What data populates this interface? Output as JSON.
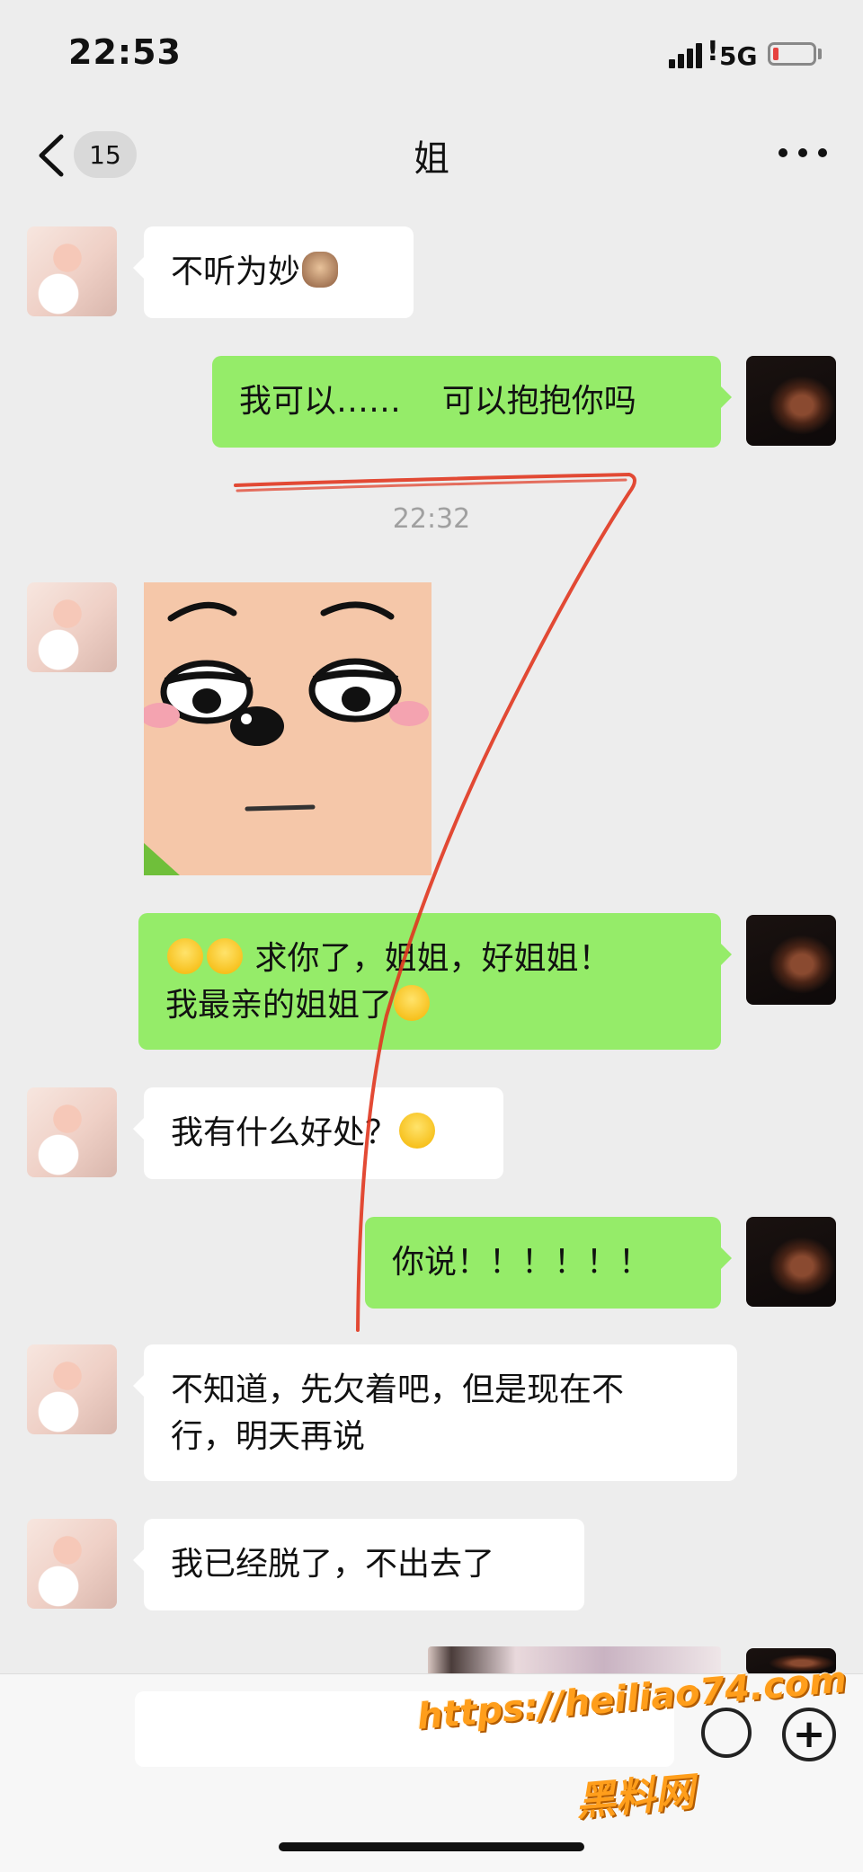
{
  "status_bar": {
    "time": "22:53",
    "signal_exclaim": "!",
    "network": "5G",
    "battery_level": 0.1
  },
  "nav": {
    "unread_count": "15",
    "title": "姐"
  },
  "messages": [
    {
      "from": "her",
      "text": "不听为妙"
    },
    {
      "from": "me",
      "text": "我可以……    可以抱抱你吗"
    },
    {
      "from": "her",
      "type": "sticker"
    },
    {
      "from": "me",
      "line1": "求你了，姐姐，好姐姐！",
      "line2": "我最亲的姐姐了"
    },
    {
      "from": "her",
      "text": "我有什么好处？"
    },
    {
      "from": "me",
      "text": "你说！！！！！！"
    },
    {
      "from": "her",
      "line1": "不知道，先欠着吧，但是现在不",
      "line2": "行，明天再说"
    },
    {
      "from": "her",
      "text": "我已经脱了，不出去了"
    },
    {
      "from": "me",
      "type": "image"
    }
  ],
  "timestamp": "22:32",
  "watermark": {
    "url": "https://heiliao74.com",
    "name": "黑料网"
  },
  "colors": {
    "background": "#ededed",
    "incoming_bubble": "#ffffff",
    "outgoing_bubble": "#95ec69",
    "watermark": "#ff9e1b",
    "annotation_stroke": "#e0361f"
  },
  "icons": [
    "back-chevron-icon",
    "more-dots-icon",
    "emoji-icon",
    "plus-icon",
    "signal-icon",
    "battery-icon"
  ]
}
